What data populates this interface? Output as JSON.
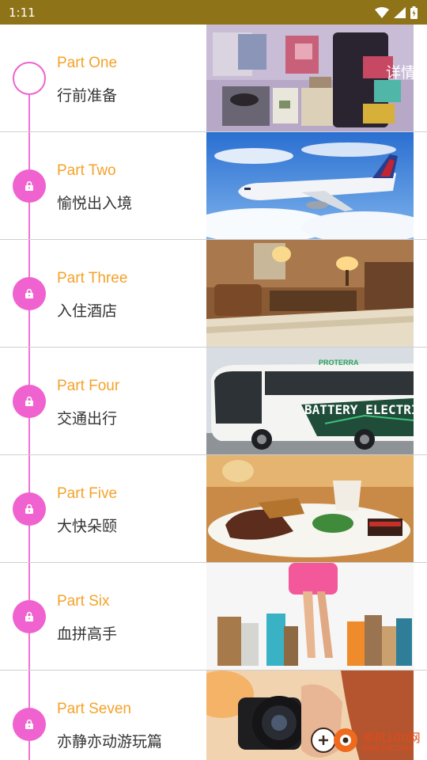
{
  "status_bar": {
    "time": "1:11",
    "icons": [
      "wifi-icon",
      "signal-icon",
      "battery-icon"
    ],
    "background": "#8f7318"
  },
  "header": {
    "detail_link": "详情"
  },
  "timeline": {
    "accent": "#ef62cf",
    "title_color": "#f4a22a"
  },
  "parts": [
    {
      "title": "Part One",
      "subtitle": "行前准备",
      "locked": false,
      "image": "packed-luggage"
    },
    {
      "title": "Part Two",
      "subtitle": "愉悦出入境",
      "locked": true,
      "image": "airplane"
    },
    {
      "title": "Part Three",
      "subtitle": "入住酒店",
      "locked": true,
      "image": "hotel-room"
    },
    {
      "title": "Part Four",
      "subtitle": "交通出行",
      "locked": true,
      "image": "electric-bus"
    },
    {
      "title": "Part Five",
      "subtitle": "大快朵颐",
      "locked": true,
      "image": "steak-dinner"
    },
    {
      "title": "Part Six",
      "subtitle": "血拼高手",
      "locked": true,
      "image": "shopping-bags"
    },
    {
      "title": "Part Seven",
      "subtitle": "亦静亦动游玩篇",
      "locked": true,
      "image": "camera-photographer"
    }
  ],
  "bus_sign": {
    "line1": "PROTERRA",
    "line2": "BATTERY ELECTRIC"
  },
  "watermark": {
    "name": "单机100网",
    "url": "danji100.com"
  }
}
